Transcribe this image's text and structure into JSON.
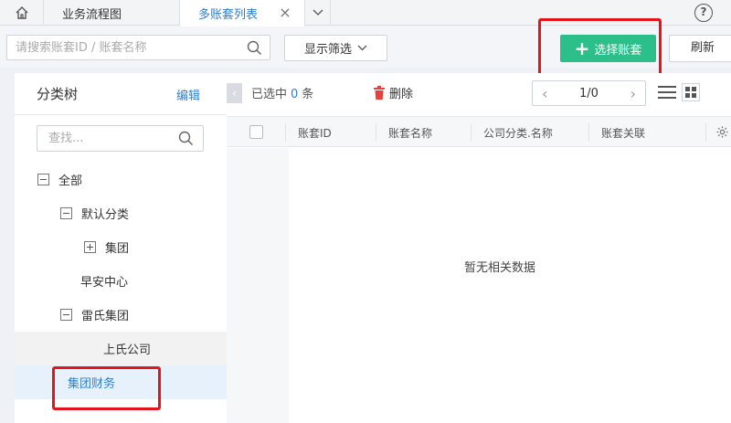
{
  "tabs": {
    "home_icon": "home-icon",
    "items": [
      {
        "label": "业务流程图"
      },
      {
        "label": "多账套列表"
      }
    ],
    "close_glyph": "×",
    "help_glyph": "?"
  },
  "toolbar": {
    "search_placeholder": "请搜索账套ID / 账套名称",
    "filter_label": "显示筛选",
    "add_label": "选择账套",
    "add_glyph": "+",
    "refresh_label": "刷新"
  },
  "sidebar": {
    "title": "分类树",
    "edit_label": "编辑",
    "search_placeholder": "查找...",
    "tree": [
      {
        "label": "全部"
      },
      {
        "label": "默认分类"
      },
      {
        "label": "集团"
      },
      {
        "label": "早安中心"
      },
      {
        "label": "雷氏集团"
      },
      {
        "label": "上氏公司"
      },
      {
        "label": "集团财务"
      }
    ]
  },
  "list": {
    "collapse_glyph": "‹",
    "selected_prefix": "已选中",
    "selected_count": "0",
    "selected_suffix": "条",
    "delete_label": "删除",
    "pager_text": "1/0",
    "pager_prev": "‹",
    "pager_next": "›",
    "columns": [
      "账套ID",
      "账套名称",
      "公司分类.名称",
      "账套关联"
    ],
    "empty_text": "暂无相关数据"
  },
  "colors": {
    "accent": "#2f7fd1",
    "primary_button": "#2dbf89",
    "highlight_box": "#e5141a",
    "delete_icon": "#e8413c"
  }
}
